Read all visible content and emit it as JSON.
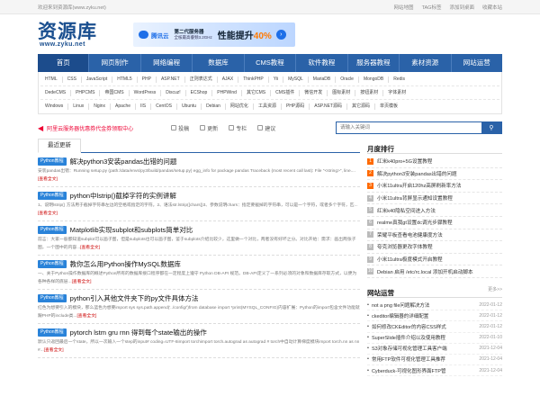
{
  "topbar": {
    "welcome": "欢迎来到资源库(www.zyku.net)",
    "links": [
      "网站地图",
      "TAG标签",
      "添加到桌面",
      "收藏本站"
    ]
  },
  "logo": {
    "text": "资源库",
    "url": "www.zyku.net"
  },
  "banner": {
    "brand": "腾讯云",
    "sub1": "第二代服务器",
    "sub2": "全核最高睿频3.2GHz",
    "big_text": "性能提升",
    "big_pct": "40%"
  },
  "nav": [
    "首页",
    "网页制作",
    "网络编程",
    "数据库",
    "CMS教程",
    "软件教程",
    "服务器教程",
    "素材资源",
    "网站运营"
  ],
  "tag_rows": [
    [
      "HTML",
      "CSS",
      "JavaScript",
      "HTML5",
      "PHP",
      "ASP.NET",
      "正则表达式",
      "AJAX",
      "ThinkPHP",
      "Yii",
      "MySQL",
      "MariaDB",
      "Oracle",
      "MongoDB",
      "Redis"
    ],
    [
      "DedeCMS",
      "PHPCMS",
      "帝国CMS",
      "WordPress",
      "Discuz!",
      "ECShop",
      "PHPWind",
      "其它CMS",
      "CMS插件",
      "微信开发",
      "图标素材",
      "按钮素材",
      "字体素材"
    ],
    [
      "Windows",
      "Linux",
      "Nginx",
      "Apache",
      "IIS",
      "CentOS",
      "Ubuntu",
      "Debian",
      "网站优化",
      "工具资源",
      "PHP源码",
      "ASP.NET源码",
      "其它源码",
      "单页模板"
    ]
  ],
  "notice": {
    "text": "阿里云服务器优惠券代金券领取中心",
    "icons": [
      "投稿",
      "更新",
      "专栏",
      "建议"
    ]
  },
  "search": {
    "placeholder": "请输入关键词"
  },
  "left_tab": "最近更新",
  "articles": [
    {
      "cat": "Python教程",
      "title": "解决python3安装pandas出错的问题",
      "desc": "安装pandas出错：Running setup.py (path:/data/envs/py3/build/pandas/setup.py) egg_info for package pandas Traceback (most recent call last): File \"<string>\", line....",
      "more": "[查看全文]"
    },
    {
      "cat": "Python教程",
      "title": "python中lstrip()截掉字符的实例讲解",
      "desc": "1、说明lstrip() 方法用于截掉字符串左边的空格或指定的字符。2、语法str.lstrip([chars])3、参数说明chars：指定要截掉的字符串，可以是一个字符，或者多个字符，匹...",
      "more": "[查看全文]"
    },
    {
      "cat": "Python教程",
      "title": "Matplotlib实现subplot和subplots简单对比",
      "desc": "前言：大家一般都知道subplot可以画子图，但是subplots也可以画子图，鉴于subplots介绍比较少，这里做一个对比，两者没有好坏之分。对比开始：需求：画出两张子图，一个图中的内容...",
      "more": "[查看全文]"
    },
    {
      "cat": "Python教程",
      "title": "教你怎么用Python操作MySQL数据库",
      "desc": "一、关于Python操作数据库的概述Python所有的数据库接口程序都在一定程度上遵守 Python DB-API 规范。DB-API定义了一系列必须的对象和数据库存取方式，以便为各种各样的底层...",
      "more": "[查看全文]"
    },
    {
      "cat": "Python教程",
      "title": "python引入其他文件夹下的py文件具体方法",
      "desc": "红色为想要引入的模块，那么蓝色为想要import sys sys.path.append('../config/')from database import *print(MYSQL_CONFIG)内容扩展：Python的import包含文件功能就跟PHP的include类...",
      "more": "[查看全文]"
    },
    {
      "cat": "Python教程",
      "title": "pytorch lstm gru rnn 得到每个state输出的操作",
      "desc": "默认只返回最后一个state，所以一次输入一个step的input# coding=UTF-8import torchimport torch.autograd as autograd # torch中自动计算梯度模块import torch.nn as nn #...",
      "more": "[查看全文]"
    }
  ],
  "rank_title": "月度排行",
  "rank": [
    "红米k40pro+5G设置教程",
    "解决python3安装pandas出错的问题",
    "小米11ultra开启120hz高屏刷新率方法",
    "小米11ultra背屏显示通知设置教程",
    "红米k40隐私空间进入方法",
    "realme真我gt设置dc调光步骤教程",
    "荣耀平板查看电池健康度方法",
    "夸克浏览器更改字体教程",
    "小米11ultra极度模式开启教程",
    "Debian 启用 /etc/rc.local 添加开机启动脚本"
  ],
  "op_title": "网站运营",
  "op_more": "更多>>",
  "ops": [
    {
      "title": "not a png file问题解决方法",
      "date": "2022-01-12"
    },
    {
      "title": "ckeditor编辑器的详细配置",
      "date": "2022-01-12"
    },
    {
      "title": "如何修改CKEditor的内容CSS样式",
      "date": "2022-01-12"
    },
    {
      "title": "SuperSlide插件介绍以及使用教程",
      "date": "2022-01-10"
    },
    {
      "title": "S3对象存储可视化管理工具客户端",
      "date": "2021-12-04"
    },
    {
      "title": "常用FTP软件可视化管理工具推荐",
      "date": "2021-12-04"
    },
    {
      "title": "Cyberduck-可视化图形界面FTP管",
      "date": "2021-12-04"
    }
  ]
}
